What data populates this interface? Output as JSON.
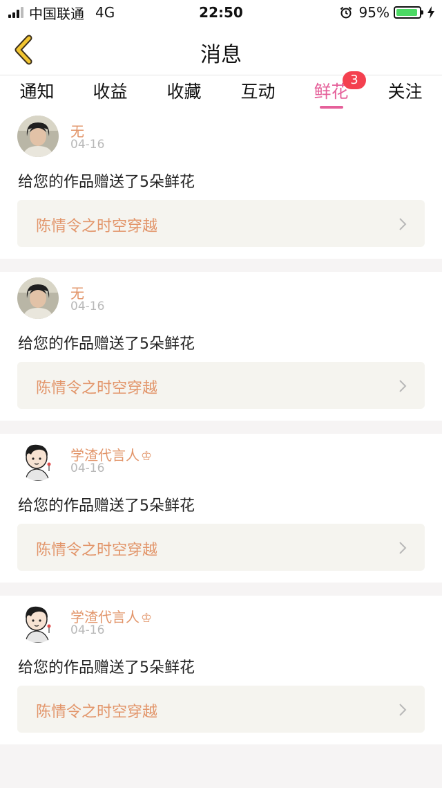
{
  "status_bar": {
    "carrier": "中国联通",
    "network": "4G",
    "time": "22:50",
    "battery": "95%",
    "battery_color": "#4cd964"
  },
  "nav": {
    "title": "消息",
    "back_icon": "chevron-left-icon",
    "back_color": "#f2c531"
  },
  "tabs": [
    {
      "label": "通知",
      "active": false
    },
    {
      "label": "收益",
      "active": false
    },
    {
      "label": "收藏",
      "active": false
    },
    {
      "label": "互动",
      "active": false
    },
    {
      "label": "鲜花",
      "active": true,
      "badge": "3"
    },
    {
      "label": "关注",
      "active": false
    }
  ],
  "accent_color": "#e5609a",
  "messages": [
    {
      "user": "无",
      "crown": "",
      "date": "04-16",
      "text": "给您的作品赠送了5朵鲜花",
      "work": "陈情令之时空穿越",
      "avatar": "photo-avatar"
    },
    {
      "user": "无",
      "crown": "",
      "date": "04-16",
      "text": "给您的作品赠送了5朵鲜花",
      "work": "陈情令之时空穿越",
      "avatar": "photo-avatar"
    },
    {
      "user": "学渣代言人",
      "crown": "♔",
      "date": "04-16",
      "text": "给您的作品赠送了5朵鲜花",
      "work": "陈情令之时空穿越",
      "avatar": "cartoon-avatar"
    },
    {
      "user": "学渣代言人",
      "crown": "♔",
      "date": "04-16",
      "text": "给您的作品赠送了5朵鲜花",
      "work": "陈情令之时空穿越",
      "avatar": "cartoon-avatar"
    }
  ]
}
